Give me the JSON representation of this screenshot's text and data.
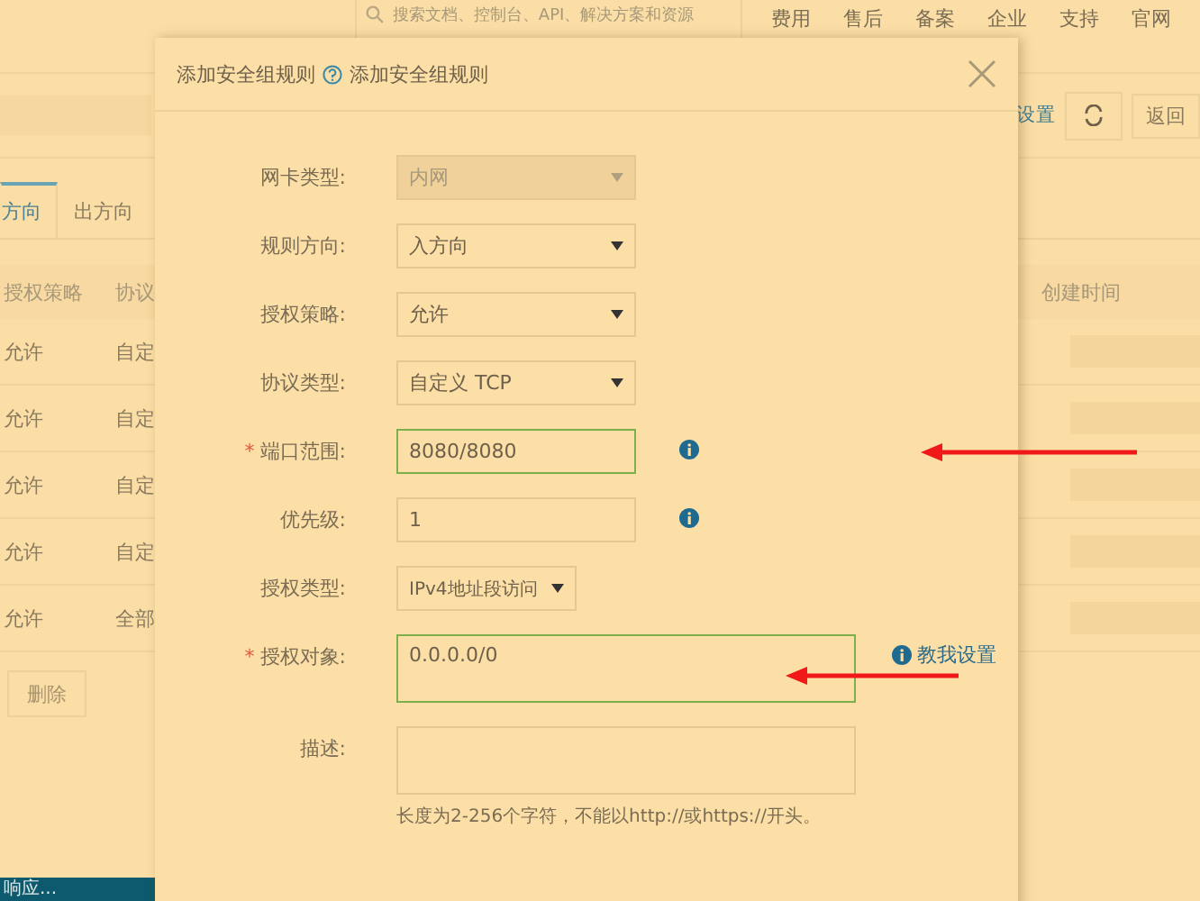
{
  "topbar": {
    "search": {
      "placeholder": "搜索文档、控制台、API、解决方案和资源"
    },
    "nav": [
      "费用",
      "售后",
      "备案",
      "企业",
      "支持",
      "官网"
    ]
  },
  "header": {
    "link": "设置",
    "back": "返回"
  },
  "tabs": [
    {
      "label": "方向",
      "selected": true
    },
    {
      "label": "出方向",
      "selected": false
    }
  ],
  "table": {
    "columns": [
      "授权策略",
      "协议",
      "创建时间"
    ],
    "rows": [
      {
        "policy": "允许",
        "protocol": "自定"
      },
      {
        "policy": "允许",
        "protocol": "自定"
      },
      {
        "policy": "允许",
        "protocol": "自定"
      },
      {
        "policy": "允许",
        "protocol": "自定"
      },
      {
        "policy": "允许",
        "protocol": "全部"
      }
    ]
  },
  "delete_button": {
    "label": "删除",
    "disabled": true
  },
  "toast": "响应...",
  "dialog": {
    "title": "添加安全组规则",
    "help_link": "添加安全组规则",
    "fields": [
      {
        "label": "网卡类型:",
        "kind": "select",
        "value": "内网",
        "disabled": true,
        "required": false,
        "validated": false,
        "compact": false,
        "info": false
      },
      {
        "label": "规则方向:",
        "kind": "select",
        "value": "入方向",
        "disabled": false,
        "required": false,
        "validated": false,
        "compact": false,
        "info": false
      },
      {
        "label": "授权策略:",
        "kind": "select",
        "value": "允许",
        "disabled": false,
        "required": false,
        "validated": false,
        "compact": false,
        "info": false
      },
      {
        "label": "协议类型:",
        "kind": "select",
        "value": "自定义 TCP",
        "disabled": false,
        "required": false,
        "validated": false,
        "compact": false,
        "info": false
      },
      {
        "label": "端口范围:",
        "kind": "input",
        "value": "8080/8080",
        "disabled": false,
        "required": "*",
        "validated": true,
        "info": true
      },
      {
        "label": "优先级:",
        "kind": "input",
        "value": "1",
        "disabled": false,
        "required": false,
        "validated": false,
        "info": true
      },
      {
        "label": "授权类型:",
        "kind": "select",
        "value": "IPv4地址段访问",
        "disabled": false,
        "required": false,
        "validated": false,
        "compact": true,
        "info": false
      },
      {
        "label": "授权对象:",
        "kind": "textarea",
        "value": "0.0.0.0/0",
        "disabled": false,
        "required": "*",
        "validated": true,
        "info": false,
        "help": "教我设置"
      },
      {
        "label": "描述:",
        "kind": "textarea",
        "disabled": false,
        "required": false,
        "validated": false,
        "info": false,
        "hint": "长度为2-256个字符，不能以http://或https://开头。"
      }
    ]
  }
}
